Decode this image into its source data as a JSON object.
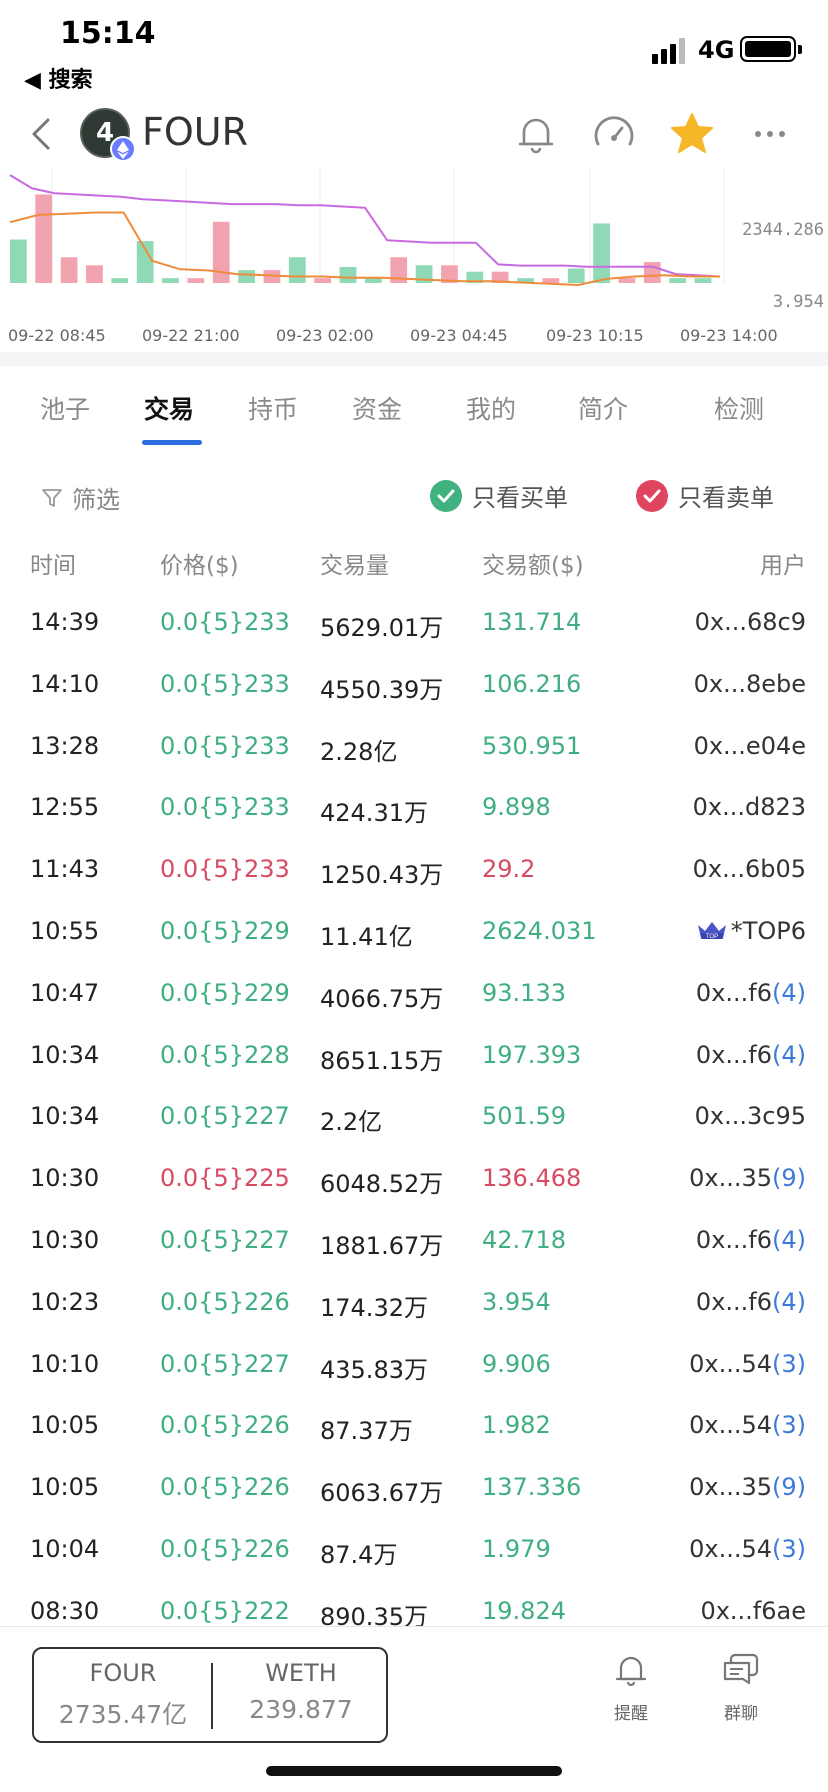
{
  "status_bar": {
    "time": "15:14",
    "back_label": "◀ 搜索",
    "network": "4G"
  },
  "header": {
    "token_glyph": "4",
    "token_name": "FOUR"
  },
  "chart_data": {
    "type": "bar",
    "right_axis_ticks": [
      "2344.286",
      "3.954"
    ],
    "x_tick_labels": [
      "09-22 08:45",
      "09-22 21:00",
      "09-23 02:00",
      "09-23 04:45",
      "09-23 10:15",
      "09-23 14:00"
    ],
    "bar_values": [
      0.27,
      0.55,
      0.16,
      0.11,
      0.03,
      0.26,
      0.03,
      0.03,
      0.38,
      0.08,
      0.08,
      0.16,
      0.03,
      0.1,
      0.03,
      0.16,
      0.11,
      0.11,
      0.07,
      0.07,
      0.03,
      0.03,
      0.09,
      0.37,
      0.03,
      0.13,
      0.03,
      0.03
    ],
    "bar_sides": [
      "buy",
      "sell",
      "sell",
      "sell",
      "buy",
      "buy",
      "buy",
      "sell",
      "sell",
      "buy",
      "sell",
      "buy",
      "sell",
      "buy",
      "buy",
      "sell",
      "buy",
      "sell",
      "buy",
      "sell",
      "buy",
      "sell",
      "buy",
      "buy",
      "sell",
      "sell",
      "buy",
      "buy"
    ],
    "price_line": [
      0.96,
      0.85,
      0.81,
      0.8,
      0.79,
      0.78,
      0.76,
      0.75,
      0.74,
      0.73,
      0.72,
      0.72,
      0.72,
      0.71,
      0.71,
      0.7,
      0.69,
      0.42,
      0.41,
      0.4,
      0.4,
      0.4,
      0.22,
      0.21,
      0.21,
      0.21,
      0.2,
      0.2,
      0.2,
      0.2,
      0.14,
      0.13,
      0.12
    ],
    "amount_line": [
      0.57,
      0.63,
      0.64,
      0.65,
      0.65,
      0.25,
      0.18,
      0.17,
      0.14,
      0.13,
      0.12,
      0.12,
      0.11,
      0.11,
      0.1,
      0.09,
      0.08,
      0.08,
      0.07,
      0.06,
      0.05,
      0.1,
      0.12,
      0.13,
      0.12,
      0.12
    ],
    "colors": {
      "buy": "#8fd9b6",
      "sell": "#f2a3b0",
      "price_line": "#c86be0",
      "amount_line": "#ee8c3a"
    }
  },
  "tabs": [
    {
      "label": "池子"
    },
    {
      "label": "交易",
      "active": true
    },
    {
      "label": "持币"
    },
    {
      "label": "资金"
    },
    {
      "label": "我的"
    },
    {
      "label": "简介"
    },
    {
      "label": "检测"
    }
  ],
  "filters": {
    "filter_label": "筛选",
    "only_buy": "只看买单",
    "only_sell": "只看卖单"
  },
  "table": {
    "headers": {
      "time": "时间",
      "price": "价格($)",
      "volume": "交易量",
      "amount": "交易额($)",
      "user": "用户"
    },
    "rows": [
      {
        "time": "14:39",
        "price": "0.0{5}233",
        "volume": "5629.01万",
        "amount": "131.714",
        "user": "0x...68c9",
        "tag": "",
        "side": "buy"
      },
      {
        "time": "14:10",
        "price": "0.0{5}233",
        "volume": "4550.39万",
        "amount": "106.216",
        "user": "0x...8ebe",
        "tag": "",
        "side": "buy"
      },
      {
        "time": "13:28",
        "price": "0.0{5}233",
        "volume": "2.28亿",
        "amount": "530.951",
        "user": "0x...e04e",
        "tag": "",
        "side": "buy"
      },
      {
        "time": "12:55",
        "price": "0.0{5}233",
        "volume": "424.31万",
        "amount": "9.898",
        "user": "0x...d823",
        "tag": "",
        "side": "buy"
      },
      {
        "time": "11:43",
        "price": "0.0{5}233",
        "volume": "1250.43万",
        "amount": "29.2",
        "user": "0x...6b05",
        "tag": "",
        "side": "sell"
      },
      {
        "time": "10:55",
        "price": "0.0{5}229",
        "volume": "11.41亿",
        "amount": "2624.031",
        "user": "*TOP6",
        "tag": "",
        "side": "buy",
        "crown": true
      },
      {
        "time": "10:47",
        "price": "0.0{5}229",
        "volume": "4066.75万",
        "amount": "93.133",
        "user": "0x...f6",
        "tag": "(4)",
        "side": "buy"
      },
      {
        "time": "10:34",
        "price": "0.0{5}228",
        "volume": "8651.15万",
        "amount": "197.393",
        "user": "0x...f6",
        "tag": "(4)",
        "side": "buy"
      },
      {
        "time": "10:34",
        "price": "0.0{5}227",
        "volume": "2.2亿",
        "amount": "501.59",
        "user": "0x...3c95",
        "tag": "",
        "side": "buy"
      },
      {
        "time": "10:30",
        "price": "0.0{5}225",
        "volume": "6048.52万",
        "amount": "136.468",
        "user": "0x...35",
        "tag": "(9)",
        "side": "sell"
      },
      {
        "time": "10:30",
        "price": "0.0{5}227",
        "volume": "1881.67万",
        "amount": "42.718",
        "user": "0x...f6",
        "tag": "(4)",
        "side": "buy"
      },
      {
        "time": "10:23",
        "price": "0.0{5}226",
        "volume": "174.32万",
        "amount": "3.954",
        "user": "0x...f6",
        "tag": "(4)",
        "side": "buy"
      },
      {
        "time": "10:10",
        "price": "0.0{5}227",
        "volume": "435.83万",
        "amount": "9.906",
        "user": "0x...54",
        "tag": "(3)",
        "side": "buy"
      },
      {
        "time": "10:05",
        "price": "0.0{5}226",
        "volume": "87.37万",
        "amount": "1.982",
        "user": "0x...54",
        "tag": "(3)",
        "side": "buy"
      },
      {
        "time": "10:05",
        "price": "0.0{5}226",
        "volume": "6063.67万",
        "amount": "137.336",
        "user": "0x...35",
        "tag": "(9)",
        "side": "buy"
      },
      {
        "time": "10:04",
        "price": "0.0{5}226",
        "volume": "87.4万",
        "amount": "1.979",
        "user": "0x...54",
        "tag": "(3)",
        "side": "buy"
      },
      {
        "time": "08:30",
        "price": "0.0{5}222",
        "volume": "890.35万",
        "amount": "19.824",
        "user": "0x...f6ae",
        "tag": "",
        "side": "buy"
      }
    ]
  },
  "bottom": {
    "pair": [
      {
        "symbol": "FOUR",
        "amount": "2735.47亿"
      },
      {
        "symbol": "WETH",
        "amount": "239.877"
      }
    ],
    "alert_label": "提醒",
    "chat_label": "群聊"
  },
  "colors": {
    "buy": "#3fae80",
    "sell": "#d74a63",
    "accent": "#2b6de0",
    "star": "#f5b728"
  }
}
